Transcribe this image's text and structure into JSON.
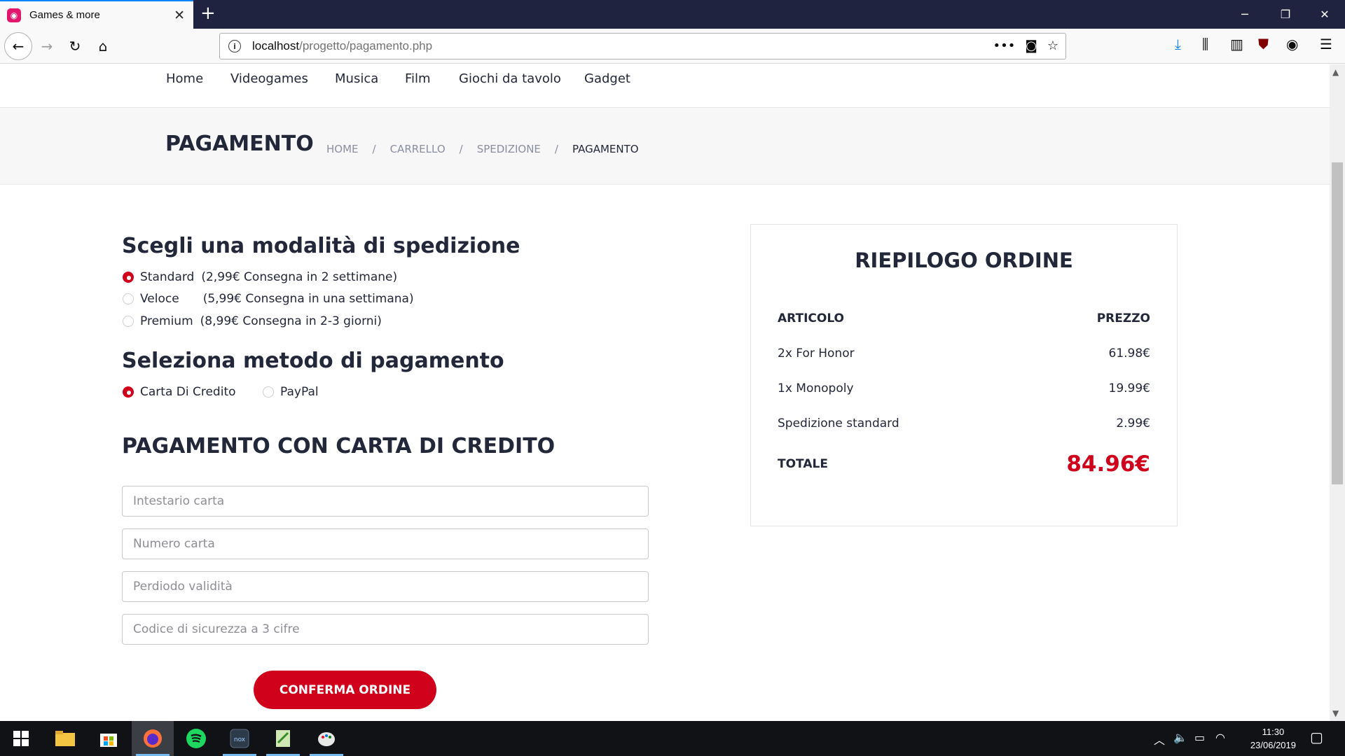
{
  "browser": {
    "tab_title": "Games & more",
    "url_host": "localhost",
    "url_path": "/progetto/pagamento.php"
  },
  "site": {
    "nav": [
      "Home",
      "Videogames",
      "Musica",
      "Film",
      "Giochi da tavolo",
      "Gadget"
    ],
    "page_title": "PAGAMENTO",
    "breadcrumbs": [
      "HOME",
      "CARRELLO",
      "SPEDIZIONE",
      "PAGAMENTO"
    ],
    "breadcrumb_sep": "/"
  },
  "shipping": {
    "heading": "Scegli una modalità di spedizione",
    "options": [
      {
        "name": "Standard",
        "detail": "(2,99€ Consegna in 2 settimane)",
        "selected": true
      },
      {
        "name": "Veloce",
        "detail": "(5,99€ Consegna in una settimana)",
        "selected": false
      },
      {
        "name": "Premium",
        "detail": "(8,99€ Consegna in 2-3 giorni)",
        "selected": false
      }
    ]
  },
  "payment": {
    "heading": "Seleziona metodo di pagamento",
    "options": [
      {
        "name": "Carta Di Credito",
        "selected": true
      },
      {
        "name": "PayPal",
        "selected": false
      }
    ]
  },
  "card_form": {
    "heading": "PAGAMENTO CON CARTA DI CREDITO",
    "placeholders": [
      "Intestario carta",
      "Numero carta",
      "Perdiodo validità",
      "Codice di sicurezza a 3 cifre"
    ],
    "submit_label": "CONFERMA ORDINE"
  },
  "summary": {
    "heading": "RIEPILOGO ORDINE",
    "col_item": "ARTICOLO",
    "col_price": "PREZZO",
    "rows": [
      {
        "item": "2x For Honor",
        "price": "61.98€"
      },
      {
        "item": "1x Monopoly",
        "price": "19.99€"
      },
      {
        "item": "Spedizione standard",
        "price": "2.99€"
      }
    ],
    "total_label": "TOTALE",
    "total_value": "84.96€"
  },
  "colors": {
    "accent": "#d0021b",
    "text": "#23273a",
    "tabbar": "#202340"
  },
  "taskbar": {
    "time": "11:30",
    "date": "23/06/2019"
  }
}
